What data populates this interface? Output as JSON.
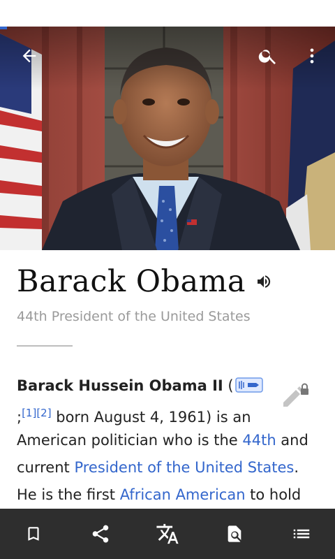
{
  "page": {
    "title": "Barack Obama",
    "subtitle": "44th President of the United States"
  },
  "article": {
    "line1": {
      "bold": "Barack Hussein Obama II",
      "open_paren": " ("
    },
    "line2": {
      "pre": ";",
      "ref1": "[1]",
      "ref2": "[2]",
      "post": " born August 4, 1961) is an"
    },
    "line3": {
      "pre": "American politician who is the ",
      "link": "44th",
      "post": " and"
    },
    "line4": {
      "pre": "current ",
      "link": "President of the United States",
      "post": "."
    },
    "line5": {
      "pre": "He is the first ",
      "link": "African American",
      "post": " to hold"
    }
  },
  "toolbar": {
    "back_icon": "arrow-left-icon",
    "search_icon": "search-icon",
    "more_icon": "more-vert-icon"
  },
  "bottom_nav": [
    {
      "icon": "bookmark-icon"
    },
    {
      "icon": "share-icon"
    },
    {
      "icon": "translate-icon"
    },
    {
      "icon": "find-in-page-icon"
    },
    {
      "icon": "table-of-contents-icon"
    }
  ],
  "colors": {
    "link": "#3366cc",
    "bottom_bar": "#2e2e2e",
    "subtitle": "#9a9a9a"
  }
}
